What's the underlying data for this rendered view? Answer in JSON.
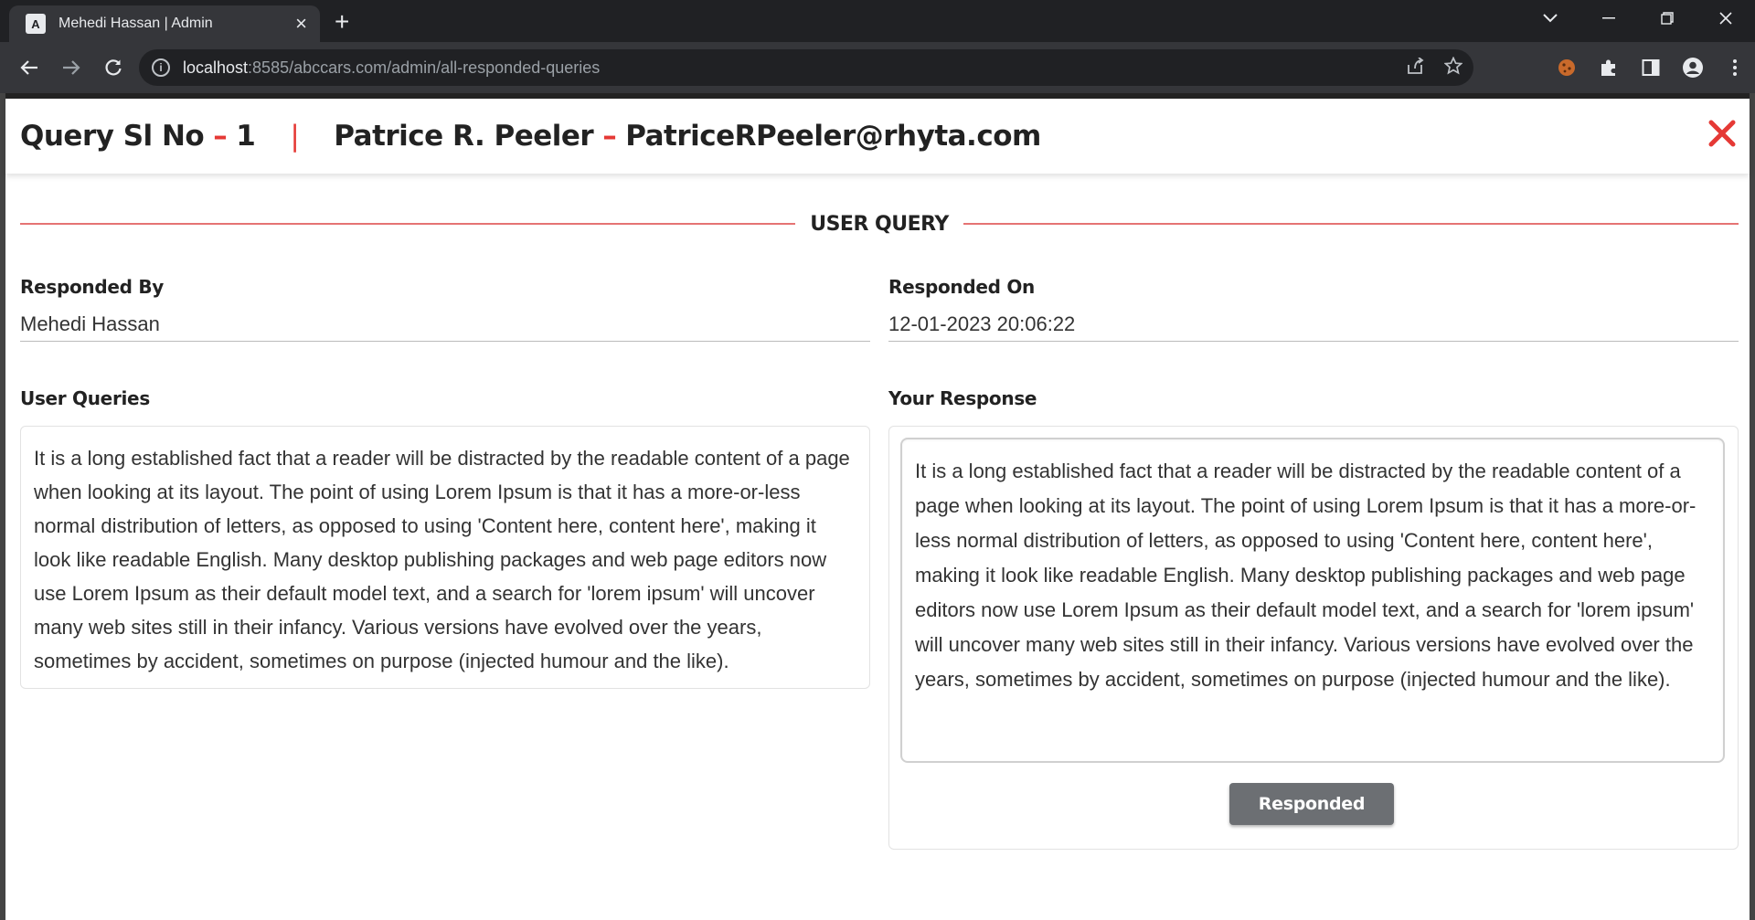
{
  "browser": {
    "tab_title": "Mehedi Hassan | Admin",
    "tab_favicon": "A",
    "url_host": "localhost",
    "url_rest": ":8585/abccars.com/admin/all-responded-queries"
  },
  "header": {
    "query_label": "Query Sl No",
    "dash1": "–",
    "query_no": "1",
    "pipe": "|",
    "user_name": "Patrice R. Peeler",
    "dash2": "–",
    "user_email": "PatriceRPeeler@rhyta.com"
  },
  "section": {
    "title": "USER QUERY"
  },
  "responded_by": {
    "label": "Responded By",
    "value": "Mehedi Hassan"
  },
  "responded_on": {
    "label": "Responded On",
    "value": "12-01-2023 20:06:22"
  },
  "user_queries": {
    "label": "User Queries",
    "text": "It is a long established fact that a reader will be distracted by the readable content of a page when looking at its layout. The point of using Lorem Ipsum is that it has a more-or-less normal distribution of letters, as opposed to using 'Content here, content here', making it look like readable English. Many desktop publishing packages and web page editors now use Lorem Ipsum as their default model text, and a search for 'lorem ipsum' will uncover many web sites still in their infancy. Various versions have evolved over the years, sometimes by accident, sometimes on purpose (injected humour and the like)."
  },
  "your_response": {
    "label": "Your Response",
    "text": "It is a long established fact that a reader will be distracted by the readable content of a page when looking at its layout. The point of using Lorem Ipsum is that it has a more-or-less normal distribution of letters, as opposed to using 'Content here, content here', making it look like readable English. Many desktop publishing packages and web page editors now use Lorem Ipsum as their default model text, and a search for 'lorem ipsum' will uncover many web sites still in their infancy. Various versions have evolved over the years, sometimes by accident, sometimes on purpose (injected humour and the like).",
    "button_label": "Responded"
  },
  "colors": {
    "accent": "#e53935",
    "button": "#6c6f73"
  }
}
